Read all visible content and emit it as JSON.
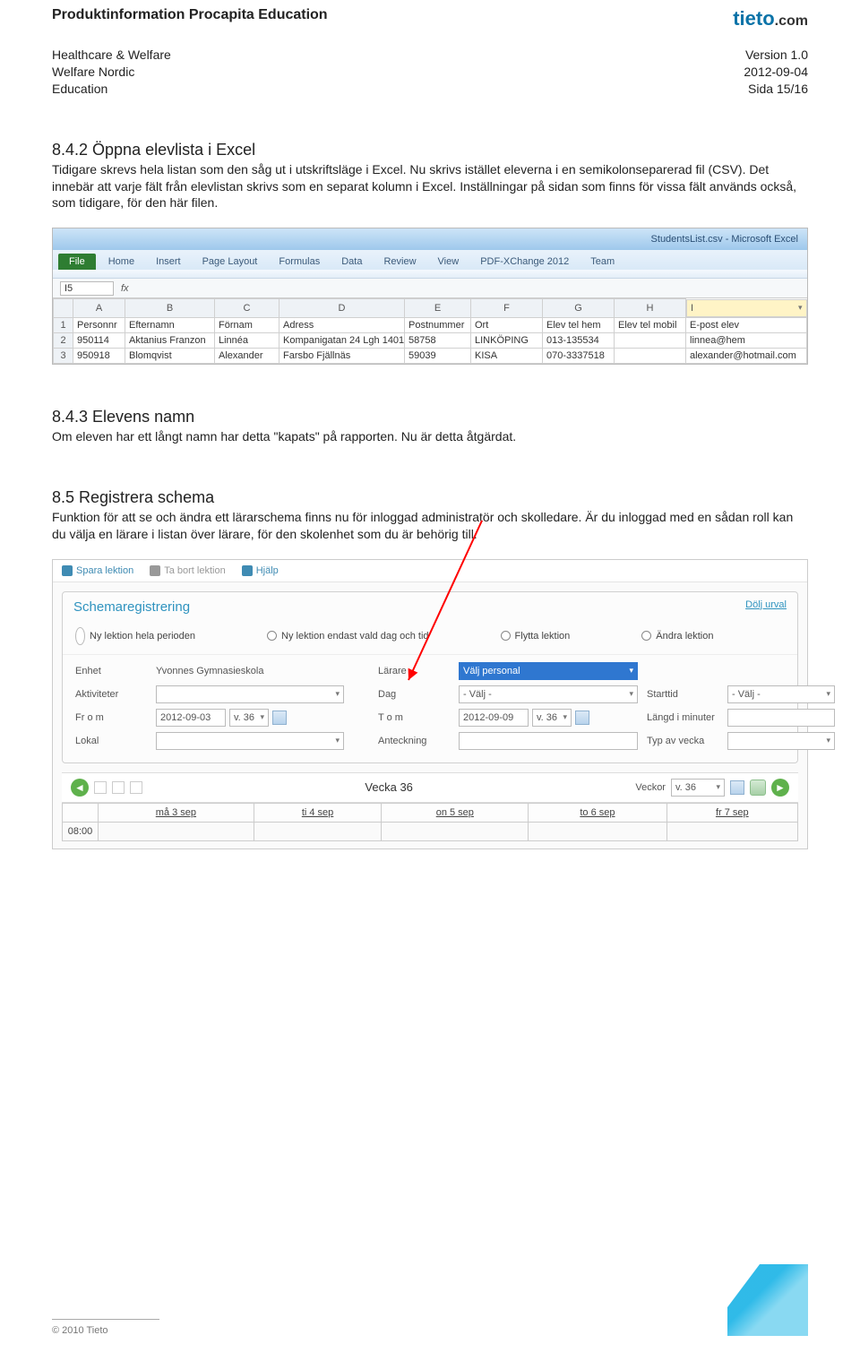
{
  "header": {
    "title": "Produktinformation Procapita Education",
    "brand_main": "tieto",
    "brand_suffix": ".com",
    "left_lines": "Healthcare & Welfare\nWelfare Nordic\nEducation",
    "right_lines": "Version 1.0\n2012-09-04\nSida 15/16"
  },
  "section_842": {
    "heading": "8.4.2 Öppna elevlista i Excel",
    "body": "Tidigare skrevs hela listan som den såg ut i utskriftsläge i Excel. Nu skrivs istället eleverna i en semikolonseparerad fil (CSV). Det innebär att varje fält från elevlistan skrivs som en separat kolumn i Excel. Inställningar på sidan som finns för vissa fält används också, som tidigare, för den här filen."
  },
  "excel": {
    "titlebar": "StudentsList.csv - Microsoft Excel",
    "tabs": [
      "File",
      "Home",
      "Insert",
      "Page Layout",
      "Formulas",
      "Data",
      "Review",
      "View",
      "PDF-XChange 2012",
      "Team"
    ],
    "namebox": "I5",
    "col_letters": [
      "A",
      "B",
      "C",
      "D",
      "E",
      "F",
      "G",
      "H",
      "I"
    ],
    "headers": [
      "Personnr",
      "Efternamn",
      "Förnam",
      "Adress",
      "Postnummer",
      "Ort",
      "Elev tel hem",
      "Elev tel mobil",
      "E-post elev"
    ],
    "rows": [
      [
        "950114",
        "Aktanius Franzon",
        "Linnéa",
        "Kompanigatan 24 Lgh 1401",
        "58758",
        "LINKÖPING",
        "013-135534",
        "",
        "linnea@hem"
      ],
      [
        "950918",
        "Blomqvist",
        "Alexander",
        "Farsbo Fjällnäs",
        "59039",
        "KISA",
        "070-3337518",
        "",
        "alexander@hotmail.com"
      ]
    ]
  },
  "section_843": {
    "heading": "8.4.3 Elevens namn",
    "body": "Om eleven har ett långt namn har detta \"kapats\" på rapporten. Nu är detta åtgärdat."
  },
  "section_85": {
    "heading": "8.5 Registrera schema",
    "body": "Funktion för att se och ändra ett lärarschema finns nu för inloggad administratör och skolledare. Är du inloggad med en sådan roll kan du välja en lärare i listan över lärare, för den skolenhet som du är behörig till."
  },
  "webapp": {
    "toolbar": {
      "save": "Spara lektion",
      "delete": "Ta bort lektion",
      "help": "Hjälp"
    },
    "panel_title": "Schemaregistrering",
    "hide_link": "Dölj urval",
    "radios": [
      "Ny lektion hela perioden",
      "Ny lektion endast vald dag och tid",
      "Flytta lektion",
      "Ändra lektion"
    ],
    "labels": {
      "enhet": "Enhet",
      "larare": "Lärare",
      "aktiv": "Aktiviteter",
      "dag": "Dag",
      "start": "Starttid",
      "from": "Fr o m",
      "tom": "T o m",
      "langd": "Längd i minuter",
      "lokal": "Lokal",
      "anteck": "Anteckning",
      "typ": "Typ av vecka"
    },
    "values": {
      "enhet": "Yvonnes Gymnasieskola",
      "larare": "Välj personal",
      "dag": "- Välj -",
      "start": "- Välj -",
      "from_date": "2012-09-03",
      "from_wk": "v. 36",
      "tom_date": "2012-09-09",
      "tom_wk": "v. 36"
    },
    "week": {
      "title": "Vecka 36",
      "veckor_lbl": "Veckor",
      "veckor_val": "v. 36",
      "days": [
        "må 3 sep",
        "ti 4 sep",
        "on 5 sep",
        "to 6 sep",
        "fr 7 sep"
      ],
      "time": "08:00"
    }
  },
  "footer": {
    "copyright": "© 2010 Tieto"
  }
}
